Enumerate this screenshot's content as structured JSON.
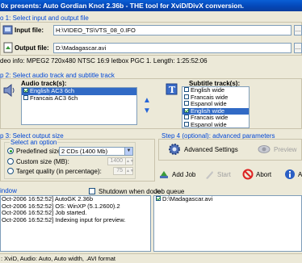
{
  "window": {
    "title": "0x presents: Auto Gordian Knot 2.36b - THE tool for XviD/DivX conversion."
  },
  "step1": {
    "title": "o 1: Select input and output file",
    "input_label": "Input file:",
    "input_value": "H:\\VIDEO_TS\\VTS_08_0.IFO",
    "output_label": "Output file:",
    "output_value": "D:\\Madagascar.avi",
    "video_info": "deo info: MPEG2 720x480 NTSC 16:9 letbox  PGC 1. Length: 1:25:52:06"
  },
  "step2": {
    "title": "p 2: Select audio track and subtitle track",
    "audio_label": "Audio track(s):",
    "audio_tracks": [
      {
        "label": "English AC3 6ch",
        "checked": true,
        "selected": true
      },
      {
        "label": "Francais AC3 6ch",
        "checked": false,
        "selected": false
      }
    ],
    "subtitle_label": "Subtitle track(s):",
    "subtitle_tracks": [
      {
        "label": "English wide",
        "checked": false,
        "selected": false
      },
      {
        "label": "Francais wide",
        "checked": false,
        "selected": false
      },
      {
        "label": "Espanol wide",
        "checked": false,
        "selected": false
      },
      {
        "label": "English wide",
        "checked": true,
        "selected": true
      },
      {
        "label": "Francais wide",
        "checked": false,
        "selected": false
      },
      {
        "label": "Espanol wide",
        "checked": false,
        "selected": false
      }
    ]
  },
  "step3": {
    "title": "p 3: Select output size",
    "option_title": "Select an option",
    "predefined_label": "Predefined size:",
    "predefined_value": "2 CDs (1400 Mb)",
    "custom_label": "Custom size (MB):",
    "custom_value": "1400",
    "target_label": "Target quality (in percentage):",
    "target_value": "75"
  },
  "step4": {
    "title": "Step 4 (optional): advanced parameters",
    "advanced_label": "Advanced Settings",
    "preview_label": "Preview"
  },
  "actions": {
    "add_job": "Add Job",
    "start": "Start",
    "abort": "Abort",
    "about": "A"
  },
  "log": {
    "title": "indow",
    "shutdown_label": "Shutdown when done",
    "lines": [
      "Oct-2006 16:52:52] AutoGK 2.36b",
      "Oct-2006 16:52:52] OS: WinXP (5.1.2600).2",
      "Oct-2006 16:52:52] Job started.",
      "Oct-2006 16:52:52] Indexing input for preview."
    ]
  },
  "queue": {
    "title": "Job queue",
    "items": [
      {
        "label": "D:\\Madagascar.avi",
        "checked": true
      }
    ]
  },
  "status": {
    "text": ": XviD, Audio: Auto, Auto width, .AVI format"
  },
  "colors": {
    "accent": "#0046d5",
    "selection": "#316ac5",
    "titlebar": "#0447b8"
  }
}
